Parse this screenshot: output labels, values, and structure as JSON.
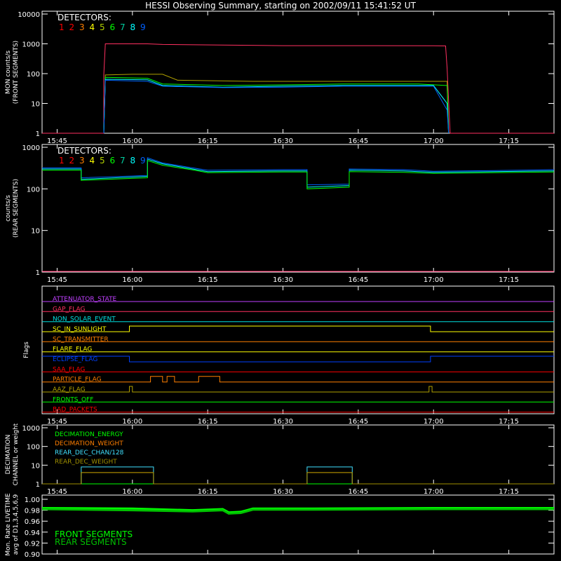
{
  "title": "HESSI Observing Summary, starting on 2002/09/11 15:41:52 UT",
  "colors": {
    "det": [
      "#ff0000",
      "#ff0000",
      "#ff7f00",
      "#ffff00",
      "#b0d000",
      "#00ff00",
      "#00d0a0",
      "#00ffff",
      "#0060ff"
    ],
    "front_det1": "#ff3060",
    "frame": "#ffffff",
    "rear_det1": "#ff2060"
  },
  "time_axis": {
    "start_label": "15:41:52",
    "ticks": [
      "15:45",
      "16:00",
      "16:15",
      "16:30",
      "16:45",
      "17:00",
      "17:15"
    ]
  },
  "chart_data": [
    {
      "type": "line",
      "name": "front",
      "ylabel_lines": [
        "MON  counts/s",
        "(FRONT SEGMENTS)"
      ],
      "ylim": [
        1,
        10000
      ],
      "yscale": "log",
      "yticks": [
        "1",
        "10",
        "100",
        "1000",
        "10000"
      ],
      "legend_title": "DETECTORS:",
      "legend_digits": [
        "1",
        "2",
        "3",
        "4",
        "5",
        "6",
        "7",
        "8",
        "9"
      ],
      "series": [
        {
          "values": [
            [
              15.7,
              1
            ],
            [
              15.905,
              1
            ],
            [
              15.905,
              90
            ],
            [
              15.91,
              1000
            ],
            [
              16.05,
              1000
            ],
            [
              16.1,
              950
            ],
            [
              16.5,
              870
            ],
            [
              16.8,
              870
            ],
            [
              17.0,
              860
            ],
            [
              17.04,
              850
            ],
            [
              17.045,
              150
            ],
            [
              17.055,
              1
            ],
            [
              17.4,
              1
            ]
          ]
        },
        {
          "values": [
            [
              15.905,
              1
            ],
            [
              15.91,
              90
            ],
            [
              16.0,
              95
            ],
            [
              16.1,
              95
            ],
            [
              16.15,
              60
            ],
            [
              16.4,
              55
            ],
            [
              16.7,
              55
            ],
            [
              17.0,
              55
            ],
            [
              17.045,
              55
            ],
            [
              17.05,
              1
            ]
          ]
        },
        {
          "values": [
            [
              15.905,
              1
            ],
            [
              15.91,
              75
            ],
            [
              16.05,
              70
            ],
            [
              16.1,
              45
            ],
            [
              16.3,
              40
            ],
            [
              16.5,
              42
            ],
            [
              16.7,
              45
            ],
            [
              16.95,
              45
            ],
            [
              17.045,
              40
            ],
            [
              17.05,
              1
            ]
          ]
        },
        {
          "values": [
            [
              15.905,
              1
            ],
            [
              15.91,
              65
            ],
            [
              16.05,
              62
            ],
            [
              16.1,
              40
            ],
            [
              16.3,
              35
            ],
            [
              16.5,
              38
            ],
            [
              16.7,
              40
            ],
            [
              17.0,
              40
            ],
            [
              17.045,
              10
            ],
            [
              17.05,
              1
            ]
          ]
        },
        {
          "values": [
            [
              15.905,
              1
            ],
            [
              15.91,
              60
            ],
            [
              16.05,
              55
            ],
            [
              16.1,
              38
            ],
            [
              16.3,
              34
            ],
            [
              16.5,
              35
            ],
            [
              16.7,
              38
            ],
            [
              17.0,
              38
            ],
            [
              17.045,
              6
            ],
            [
              17.05,
              1
            ]
          ]
        }
      ]
    },
    {
      "type": "line",
      "name": "rear",
      "ylabel_lines": [
        "counts/s",
        "(REAR SEGMENTS)"
      ],
      "ylim": [
        1,
        1000
      ],
      "yscale": "log",
      "yticks": [
        "1",
        "10",
        "100",
        "1000"
      ],
      "legend_title": "DETECTORS:",
      "legend_digits": [
        "1",
        "2",
        "3",
        "4",
        "5",
        "6",
        "7",
        "8",
        "9"
      ],
      "series": [
        {
          "values": [
            [
              15.7,
              300
            ],
            [
              15.83,
              300
            ],
            [
              15.83,
              170
            ],
            [
              16.05,
              200
            ],
            [
              16.05,
              520
            ],
            [
              16.1,
              400
            ],
            [
              16.2,
              300
            ],
            [
              16.25,
              260
            ],
            [
              16.5,
              270
            ],
            [
              16.58,
              270
            ],
            [
              16.58,
              110
            ],
            [
              16.72,
              120
            ],
            [
              16.72,
              280
            ],
            [
              16.9,
              270
            ],
            [
              17.0,
              250
            ],
            [
              17.2,
              260
            ],
            [
              17.4,
              270
            ]
          ]
        },
        {
          "values": [
            [
              15.7,
              320
            ],
            [
              15.83,
              320
            ],
            [
              15.83,
              185
            ],
            [
              16.05,
              210
            ],
            [
              16.05,
              560
            ],
            [
              16.1,
              420
            ],
            [
              16.2,
              320
            ],
            [
              16.25,
              280
            ],
            [
              16.5,
              290
            ],
            [
              16.58,
              290
            ],
            [
              16.58,
              125
            ],
            [
              16.72,
              130
            ],
            [
              16.72,
              300
            ],
            [
              16.9,
              290
            ],
            [
              17.0,
              265
            ],
            [
              17.2,
              275
            ],
            [
              17.4,
              290
            ]
          ]
        },
        {
          "values": [
            [
              15.7,
              280
            ],
            [
              15.83,
              280
            ],
            [
              15.83,
              160
            ],
            [
              16.05,
              185
            ],
            [
              16.05,
              480
            ],
            [
              16.1,
              370
            ],
            [
              16.2,
              285
            ],
            [
              16.25,
              245
            ],
            [
              16.5,
              255
            ],
            [
              16.58,
              255
            ],
            [
              16.58,
              100
            ],
            [
              16.72,
              110
            ],
            [
              16.72,
              260
            ],
            [
              16.9,
              250
            ],
            [
              17.0,
              235
            ],
            [
              17.2,
              245
            ],
            [
              17.4,
              255
            ]
          ]
        }
      ]
    },
    {
      "type": "step",
      "name": "flags",
      "ylabel": "Flags",
      "flags": [
        {
          "label": "ATTENUATOR_STATE",
          "color": "#c040ff"
        },
        {
          "label": "GAP_FLAG",
          "color": "#ff3060"
        },
        {
          "label": "NON_SOLAR_EVENT",
          "color": "#00e0e0"
        },
        {
          "label": "SC_IN_SUNLIGHT",
          "color": "#ffff00",
          "on": [
            [
              15.99,
              16.99
            ]
          ]
        },
        {
          "label": "SC_TRANSMITTER",
          "color": "#ff7f00"
        },
        {
          "label": "FLARE_FLAG",
          "color": "#ffff00"
        },
        {
          "label": "ECLIPSE_FLAG",
          "color": "#0040ff",
          "on": [
            [
              15.7,
              15.99
            ],
            [
              16.99,
              17.4
            ]
          ]
        },
        {
          "label": "SAA_FLAG",
          "color": "#ff0000"
        },
        {
          "label": "PARTICLE_FLAG",
          "color": "#ff7f00",
          "on": [
            [
              16.06,
              16.1
            ],
            [
              16.115,
              16.14
            ],
            [
              16.22,
              16.29
            ]
          ]
        },
        {
          "label": "AAZ_FLAG",
          "color": "#b0a000",
          "on": [
            [
              15.99,
              16.0
            ],
            [
              16.985,
              16.995
            ]
          ]
        },
        {
          "label": "FRONTS_OFF",
          "color": "#00ff00"
        },
        {
          "label": "BAD_PACKETS",
          "color": "#ff0000"
        }
      ]
    },
    {
      "type": "step",
      "name": "decimation",
      "ylabel_lines": [
        "DECIMATION",
        "CHANNEL or weight"
      ],
      "ylim": [
        1,
        1000
      ],
      "yscale": "log",
      "yticks": [
        "1",
        "10",
        "100",
        "1000"
      ],
      "series": [
        {
          "name": "DECIMATION_ENERGY",
          "color": "#00ff00",
          "values": [
            [
              15.7,
              1
            ],
            [
              17.4,
              1
            ]
          ]
        },
        {
          "name": "DECIMATION_WEIGHT",
          "color": "#ff7f00",
          "values": [
            [
              15.7,
              1
            ],
            [
              15.83,
              1
            ],
            [
              15.83,
              4
            ],
            [
              16.07,
              4
            ],
            [
              16.07,
              1
            ],
            [
              16.58,
              1
            ],
            [
              16.58,
              4
            ],
            [
              16.73,
              4
            ],
            [
              16.73,
              1
            ],
            [
              17.4,
              1
            ]
          ]
        },
        {
          "name": "REAR_DEC_CHAN/128",
          "color": "#40e0ff",
          "values": [
            [
              15.7,
              1
            ],
            [
              15.83,
              1
            ],
            [
              15.83,
              8
            ],
            [
              16.07,
              8
            ],
            [
              16.07,
              1
            ],
            [
              16.58,
              1
            ],
            [
              16.58,
              8
            ],
            [
              16.73,
              8
            ],
            [
              16.73,
              1
            ],
            [
              17.4,
              1
            ]
          ]
        },
        {
          "name": "REAR_DEC_WEIGHT",
          "color": "#a09000",
          "values": [
            [
              15.7,
              1
            ],
            [
              15.83,
              1
            ],
            [
              15.83,
              4
            ],
            [
              16.07,
              4
            ],
            [
              16.07,
              1
            ],
            [
              16.58,
              1
            ],
            [
              16.58,
              4
            ],
            [
              16.73,
              4
            ],
            [
              16.73,
              1
            ],
            [
              17.4,
              1
            ]
          ]
        }
      ]
    },
    {
      "type": "line",
      "name": "livetime",
      "ylabel_lines": [
        "Mon. Rate LIVETIME",
        "avg of D1,3,4,5,6,9"
      ],
      "ylim": [
        0.9,
        1.0
      ],
      "yticks": [
        "0.90",
        "0.92",
        "0.94",
        "0.96",
        "0.98",
        "1.00"
      ],
      "legend": [
        "FRONT SEGMENTS",
        "REAR SEGMENTS"
      ],
      "series": [
        {
          "name": "FRONT SEGMENTS",
          "color": "#00ff00",
          "values": [
            [
              15.7,
              0.984
            ],
            [
              16.0,
              0.983
            ],
            [
              16.2,
              0.98
            ],
            [
              16.3,
              0.982
            ],
            [
              16.32,
              0.976
            ],
            [
              16.36,
              0.977
            ],
            [
              16.4,
              0.983
            ],
            [
              16.6,
              0.983
            ],
            [
              17.0,
              0.984
            ],
            [
              17.4,
              0.984
            ]
          ]
        },
        {
          "name": "REAR SEGMENTS",
          "color": "#00c000",
          "values": [
            [
              15.7,
              0.982
            ],
            [
              16.0,
              0.98
            ],
            [
              16.2,
              0.978
            ],
            [
              16.3,
              0.98
            ],
            [
              16.32,
              0.974
            ],
            [
              16.36,
              0.975
            ],
            [
              16.4,
              0.981
            ],
            [
              16.6,
              0.981
            ],
            [
              17.0,
              0.982
            ],
            [
              17.4,
              0.982
            ]
          ]
        }
      ]
    }
  ]
}
